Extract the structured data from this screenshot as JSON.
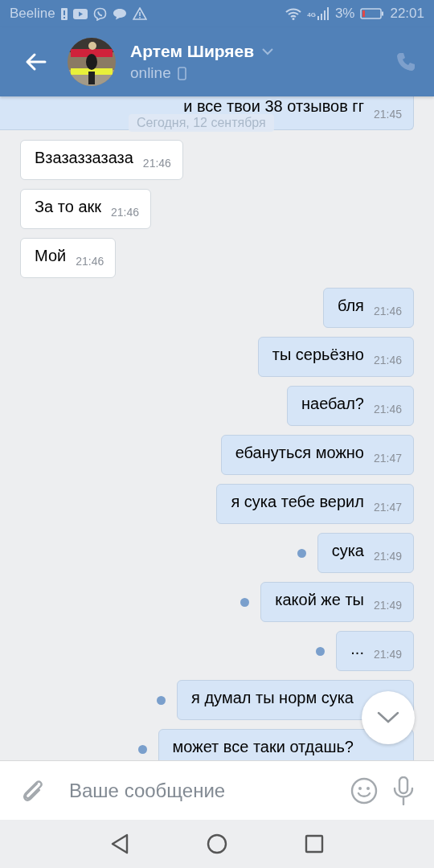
{
  "status_bar": {
    "carrier": "Beeline",
    "network": "4G",
    "battery": "3%",
    "time": "22:01"
  },
  "header": {
    "name": "Артем Ширяев",
    "status": "online"
  },
  "date_label": "Сегодня, 12 сентября",
  "messages": [
    {
      "kind": "outgoing",
      "text": "и все твои 38 отзывов гг",
      "time": "21:45",
      "unread": false
    },
    {
      "kind": "incoming",
      "text": "Взазаззазаза",
      "time": "21:46",
      "unread": false
    },
    {
      "kind": "incoming",
      "text": "За то акк",
      "time": "21:46",
      "unread": false
    },
    {
      "kind": "incoming",
      "text": "Мой",
      "time": "21:46",
      "unread": false
    },
    {
      "kind": "outgoing",
      "text": "бля",
      "time": "21:46",
      "unread": false
    },
    {
      "kind": "outgoing",
      "text": "ты серьёзно",
      "time": "21:46",
      "unread": false
    },
    {
      "kind": "outgoing",
      "text": "наебал?",
      "time": "21:46",
      "unread": false
    },
    {
      "kind": "outgoing",
      "text": "ебануться можно",
      "time": "21:47",
      "unread": false
    },
    {
      "kind": "outgoing",
      "text": "я сука тебе верил",
      "time": "21:47",
      "unread": false
    },
    {
      "kind": "outgoing",
      "text": "сука",
      "time": "21:49",
      "unread": true
    },
    {
      "kind": "outgoing",
      "text": "какой же ты",
      "time": "21:49",
      "unread": true
    },
    {
      "kind": "outgoing",
      "text": "...",
      "time": "21:49",
      "unread": true
    },
    {
      "kind": "outgoing",
      "text": "я думал ты норм сука",
      "unread": true
    },
    {
      "kind": "outgoing",
      "text": "может все таки отдашь?",
      "unread": true
    }
  ],
  "composer": {
    "placeholder": "Ваше сообщение"
  }
}
